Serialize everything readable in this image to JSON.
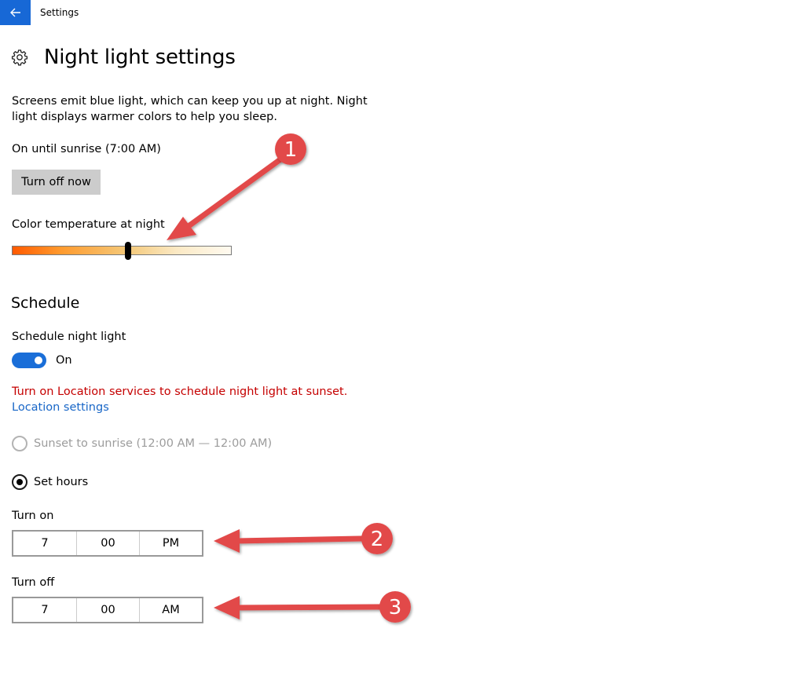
{
  "window": {
    "title": "Settings"
  },
  "icons": {
    "back": "back-arrow-icon",
    "settings": "gear-icon"
  },
  "colors": {
    "accent": "#1a6ed8",
    "titlebar_button": "#1768d6",
    "warning": "#c50000",
    "link": "#1866c7",
    "annotation": "#e24a4a"
  },
  "page": {
    "title": "Night light settings"
  },
  "description": "Screens emit blue light, which can keep you up at night. Night light displays warmer colors to help you sleep.",
  "status": "On until sunrise (7:00 AM)",
  "turn_off_button": "Turn off now",
  "color_temperature": {
    "label": "Color temperature at night",
    "value_fraction": 0.53
  },
  "schedule": {
    "title": "Schedule",
    "toggle_label": "Schedule night light",
    "toggle_state": "On",
    "warning": "Turn on Location services to schedule night light at sunset.",
    "location_link": "Location settings",
    "options": [
      {
        "label": "Sunset to sunrise (12:00 AM — 12:00 AM)",
        "selected": false,
        "enabled": false
      },
      {
        "label": "Set hours",
        "selected": true,
        "enabled": true
      }
    ]
  },
  "turn_on": {
    "label": "Turn on",
    "hour": "7",
    "minute": "00",
    "period": "PM"
  },
  "turn_off": {
    "label": "Turn off",
    "hour": "7",
    "minute": "00",
    "period": "AM"
  },
  "annotations": [
    "1",
    "2",
    "3"
  ]
}
